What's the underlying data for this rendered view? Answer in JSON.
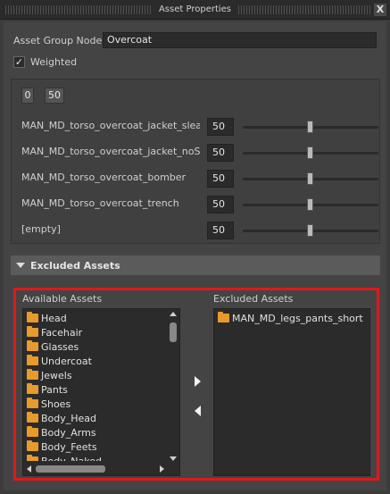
{
  "window": {
    "title": "Asset Properties",
    "close_glyph": "X"
  },
  "asset_group": {
    "label": "Asset Group Node",
    "value": "Overcoat"
  },
  "weighted": {
    "label": "Weighted",
    "checked": true,
    "check_glyph": "✓"
  },
  "range": {
    "min": "0",
    "max": "50"
  },
  "weights": [
    {
      "name": "MAN_MD_torso_overcoat_jacket_sleave",
      "value": "50",
      "slider": 0.5
    },
    {
      "name": "MAN_MD_torso_overcoat_jacket_noSleave",
      "value": "50",
      "slider": 0.5
    },
    {
      "name": "MAN_MD_torso_overcoat_bomber",
      "value": "50",
      "slider": 0.5
    },
    {
      "name": "MAN_MD_torso_overcoat_trench",
      "value": "50",
      "slider": 0.5
    },
    {
      "name": "[empty]",
      "value": "50",
      "slider": 0.5
    }
  ],
  "excluded_section": {
    "title": "Excluded Assets",
    "expanded": true
  },
  "available": {
    "label": "Available Assets",
    "items": [
      "Head",
      "Facehair",
      "Glasses",
      "Undercoat",
      "Jewels",
      "Pants",
      "Shoes",
      "Body_Head",
      "Body_Arms",
      "Body_Feets",
      "Body_Naked"
    ]
  },
  "excluded": {
    "label": "Excluded Assets",
    "items": [
      "MAN_MD_legs_pants_short"
    ]
  },
  "colors": {
    "highlight_frame": "#e0181c",
    "folder": "#e89a2c"
  },
  "icons": {
    "folder": "folder-icon",
    "move_right": "arrow-right-icon",
    "move_left": "arrow-left-icon"
  }
}
